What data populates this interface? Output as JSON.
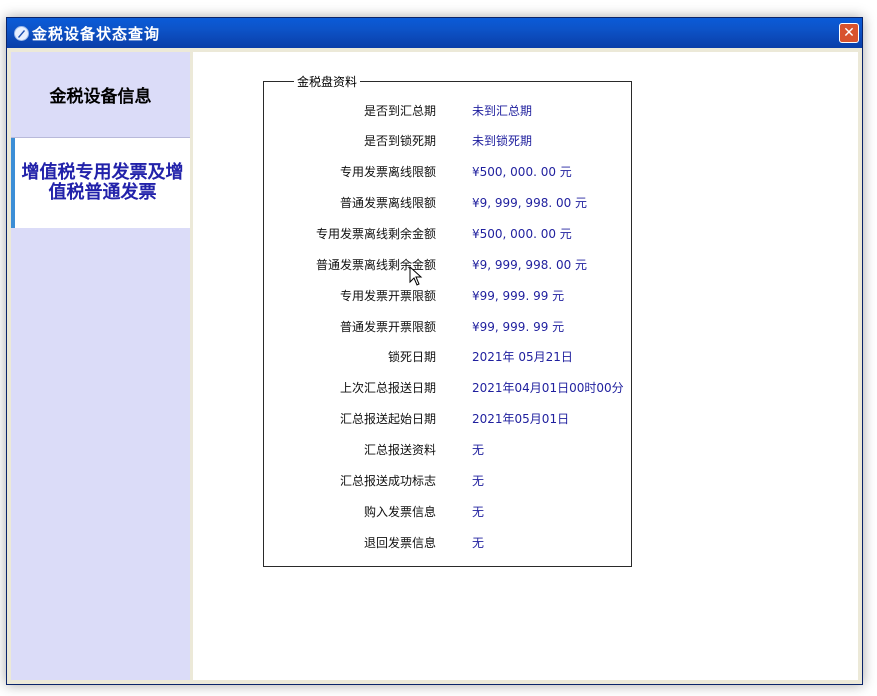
{
  "window": {
    "title": "金税设备状态查询",
    "close_label": "✕"
  },
  "sidebar": {
    "items": [
      {
        "label": "金税设备信息"
      },
      {
        "label": "增值税专用发票及增值税普通发票"
      }
    ]
  },
  "panel": {
    "group_title": "金税盘资料",
    "rows": [
      {
        "label": "是否到汇总期",
        "value": "未到汇总期"
      },
      {
        "label": "是否到锁死期",
        "value": "未到锁死期"
      },
      {
        "label": "专用发票离线限额",
        "value": "¥500, 000. 00 元"
      },
      {
        "label": "普通发票离线限额",
        "value": "¥9, 999, 998. 00 元"
      },
      {
        "label": "专用发票离线剩余金额",
        "value": "¥500, 000. 00 元"
      },
      {
        "label": "普通发票离线剩余金额",
        "value": "¥9, 999, 998. 00 元"
      },
      {
        "label": "专用发票开票限额",
        "value": "¥99, 999. 99 元"
      },
      {
        "label": "普通发票开票限额",
        "value": "¥99, 999. 99 元"
      },
      {
        "label": "锁死日期",
        "value": "2021年 05月21日"
      },
      {
        "label": "上次汇总报送日期",
        "value": "2021年04月01日00时00分"
      },
      {
        "label": "汇总报送起始日期",
        "value": "2021年05月01日"
      },
      {
        "label": "汇总报送资料",
        "value": "无"
      },
      {
        "label": "汇总报送成功标志",
        "value": "无"
      },
      {
        "label": "购入发票信息",
        "value": "无"
      },
      {
        "label": "退回发票信息",
        "value": "无"
      }
    ]
  },
  "icons": {
    "title_icon": "app-icon",
    "close_icon": "close-icon",
    "cursor": "mouse-pointer-icon"
  }
}
